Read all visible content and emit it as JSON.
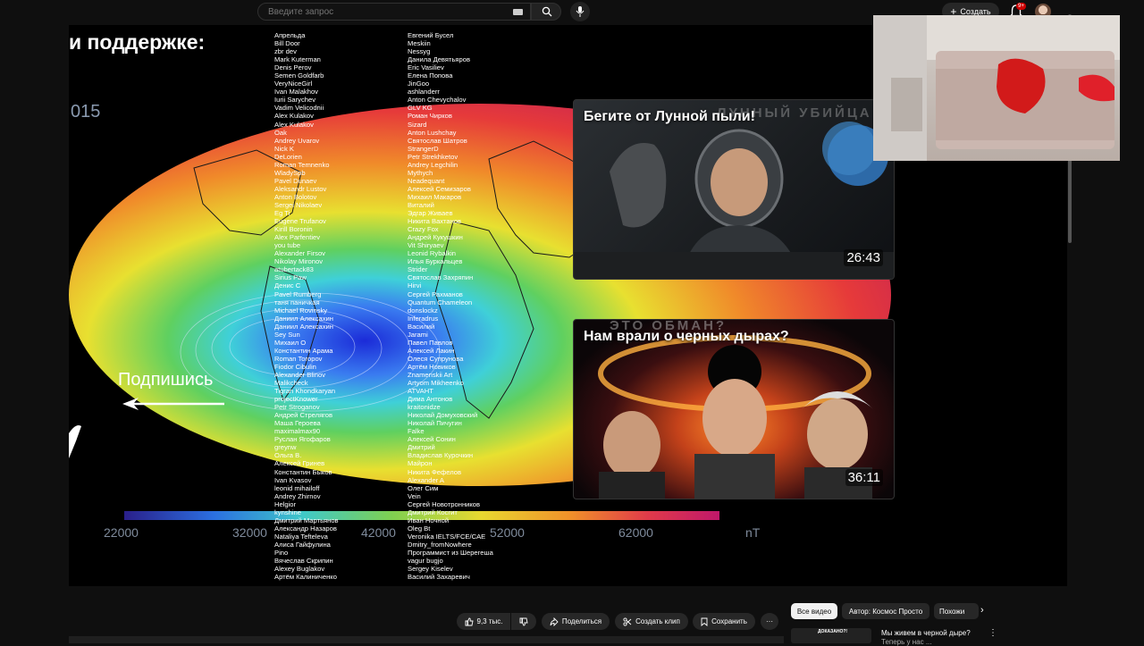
{
  "header": {
    "search_placeholder": "Введите запрос",
    "create_label": "Создать",
    "notifications_badge": "9+"
  },
  "video": {
    "heading": "и поддержке:",
    "year": "015",
    "subscribe_label": "Подпишись",
    "names_col1": [
      "Апрельда",
      "Bill Door",
      "zbr dev",
      "Mark Kuterman",
      "Denis Perov",
      "Semen Goldfarb",
      "VeryNiceGirl",
      "Ivan Malakhov",
      "Iurii Sarychev",
      "Vadim Velicodnii",
      "Alex Kulakov",
      "Alex Kulakov",
      "Oak",
      "Andrey Uvarov",
      "Nick K",
      "DeLorien",
      "Roman Temnenko",
      "WladySpb",
      "Pavel Dunaev",
      "Aleksandr Lustov",
      "Anton Bolotov",
      "Sergei Nikolaev",
      "Eg Ti",
      "Eugene Trufanov",
      "Kirill Boronin",
      "Alex Parfentiev",
      "you tube",
      "Alexander Firsov",
      "Nikolay Mironov",
      "atubertack83",
      "Sirius Paw",
      "Денис С",
      "Pavel Rumberg",
      "таня паничкая",
      "Michael Rovinsky",
      "Даниил Алексахин",
      "Даниил Алексахин",
      "Sey Sun",
      "Михаил О",
      "Константин Арама",
      "Roman Toropov",
      "Fiodor Cibulin",
      "Alexander Blinov",
      "Malikcheck",
      "Tigran Khondkaryan",
      "projectKnower",
      "Petr Stroganov",
      "Андрей Стрелягов",
      "Маша Героева",
      "maximalmax90",
      "Руслан Ягофаров",
      "greynw",
      "Ольга В.",
      "Алексей Гринев",
      "Константин Быков",
      "Ivan Kvasov",
      "leonid mihailoff",
      "Andrey Zhirnov",
      "Helgior",
      "kynshine",
      "Дмитрий Мартьянов",
      "Александр Назаров",
      "Nataliya Tefteleva",
      "Алиса Гайфулина",
      "Pino",
      "Вячеслав Скрипин",
      "Alexey Buglakov",
      "Артём Калиниченко"
    ],
    "names_col2": [
      "Евгений Бусел",
      "Meskiin",
      "Nessyg",
      "Данила Девятьяров",
      "Eric Vasiliev",
      "Елена Попова",
      "JinGoo",
      "ashlanderr",
      "Anton Chevychalov",
      "GLV KG",
      "Роман Чирков",
      "Sizard",
      "Anton Lushchay",
      "Святослав Шатров",
      "StrangerD",
      "Petr Strekhketov",
      "Andrey Legchilin",
      "Mythych",
      "Neadequant",
      "Алексей Семизаров",
      "Михаил Макаров",
      "Виталий",
      "Эдгар Живаев",
      "Никита Вахтанов",
      "Crazy Fox",
      "Андрей Кукушкин",
      "Vit Shiryaev",
      "Leonid Rybalkin",
      "Илья Буркальцев",
      "Strider",
      "Святослав Захряпин",
      "Hirvi",
      "Сергей Рахманов",
      "Quantum Chameleon",
      "donslockz",
      "Inferadrus",
      "Василий",
      "Jarami",
      "Павел Павлов",
      "Алексей Лакин",
      "Олеся Супрунова",
      "Артём Новиков",
      "Znamenskii Art",
      "Artyom Mikheenko",
      "ATVAHT",
      "Дима Антонов",
      "kraitonidze",
      "Николай Домуховский",
      "Николай Пичугин",
      "Falke",
      "Алексей Сонин",
      "Дмитрий",
      "Владислав Курочкин",
      "Майрон",
      "Никита Фефелов",
      "Alexander A",
      "Олег Сим",
      "Vein",
      "Сергей Новотронников",
      "Дмитрий Косгит",
      "Иван Ночной",
      "Oleg Bt",
      "Veronika IELTS/FCE/CAE",
      "Dmitry_fromNowhere",
      "Программист из Шерегеша",
      "vagur bugjo",
      "Sergey Kiselev",
      "Василий Захаревич"
    ],
    "colorbar_ticks": [
      "22000",
      "32000",
      "42000",
      "52000",
      "62000"
    ],
    "colorbar_unit": "nT"
  },
  "endcards": [
    {
      "title": "Бегите от Лунной пыли!",
      "ghost_text": "ЛУННЫЙ УБИЙЦА",
      "duration": "26:43"
    },
    {
      "title": "Нам врали о черных дырах?",
      "ghost_text": "ЭТО ОБМАН?",
      "duration": "36:11"
    }
  ],
  "actions": {
    "likes": "9,3 тыс.",
    "share": "Поделиться",
    "clip": "Создать клип",
    "save": "Сохранить",
    "more": "···"
  },
  "chips": [
    "Все видео",
    "Автор: Космос Просто",
    "Похожи"
  ],
  "recommendation": {
    "thumb_text": "ДОКАЗАНО?!",
    "title": "Мы живем в черной дыре?",
    "subtitle": "Теперь у нас ..."
  },
  "colors": {
    "background": "#0f0f0f",
    "chip_active": "#f1f1f1",
    "badge": "#cc0000"
  }
}
